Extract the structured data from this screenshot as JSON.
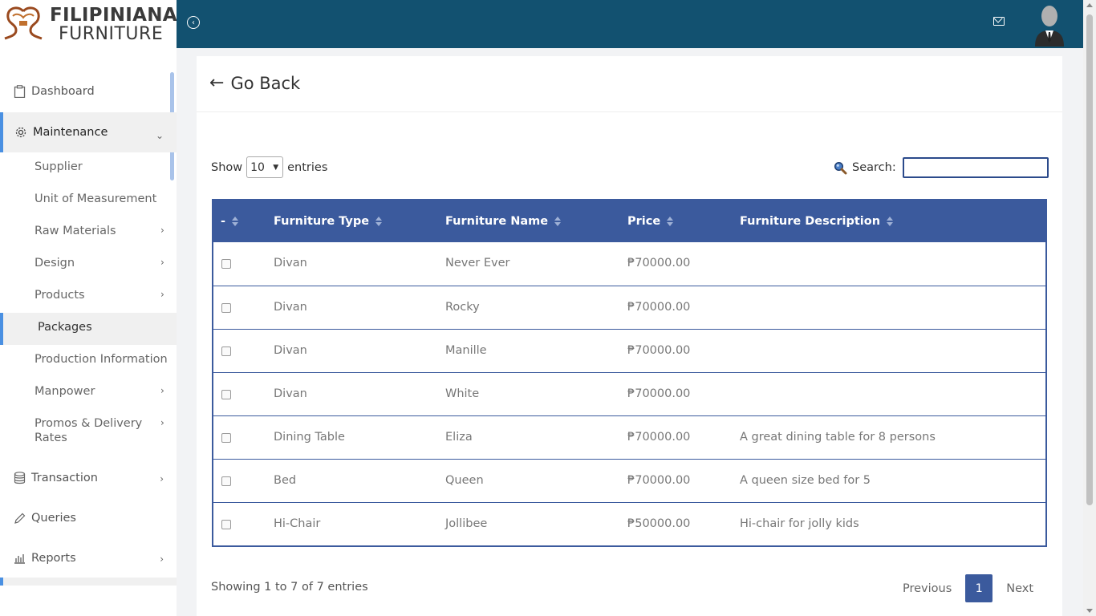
{
  "brand": {
    "line1": "FILIPINIANA",
    "line2": "FURNITURE"
  },
  "sidebar": {
    "dashboard": "Dashboard",
    "maintenance": "Maintenance",
    "sub": {
      "supplier": "Supplier",
      "uom": "Unit of Measurement",
      "raw": "Raw Materials",
      "design": "Design",
      "products": "Products",
      "packages": "Packages",
      "production": "Production Information",
      "manpower": "Manpower",
      "promos1": "Promos & Delivery",
      "promos2": "Rates"
    },
    "transaction": "Transaction",
    "queries": "Queries",
    "reports": "Reports"
  },
  "page": {
    "goback": "Go Back"
  },
  "table_controls": {
    "show": "Show",
    "entries": "entries",
    "length_value": "10",
    "search_label": "Search:",
    "search_value": ""
  },
  "table": {
    "headers": {
      "check": "-",
      "type": "Furniture Type",
      "name": "Furniture Name",
      "price": "Price",
      "desc": "Furniture Description"
    },
    "rows": [
      {
        "type": "Divan",
        "name": "Never Ever",
        "price": "₱70000.00",
        "desc": ""
      },
      {
        "type": "Divan",
        "name": "Rocky",
        "price": "₱70000.00",
        "desc": ""
      },
      {
        "type": "Divan",
        "name": "Manille",
        "price": "₱70000.00",
        "desc": ""
      },
      {
        "type": "Divan",
        "name": "White",
        "price": "₱70000.00",
        "desc": ""
      },
      {
        "type": "Dining Table",
        "name": "Eliza",
        "price": "₱70000.00",
        "desc": "A great dining table for 8 persons"
      },
      {
        "type": "Bed",
        "name": "Queen",
        "price": "₱70000.00",
        "desc": "A queen size bed for 5"
      },
      {
        "type": "Hi-Chair",
        "name": "Jollibee",
        "price": "₱50000.00",
        "desc": "Hi-chair for jolly kids"
      }
    ]
  },
  "footer": {
    "info": "Showing 1 to 7 of 7 entries",
    "previous": "Previous",
    "page": "1",
    "next": "Next"
  },
  "colors": {
    "topbar": "#125170",
    "accent": "#3b5a9d",
    "active_border": "#4a90e2"
  }
}
